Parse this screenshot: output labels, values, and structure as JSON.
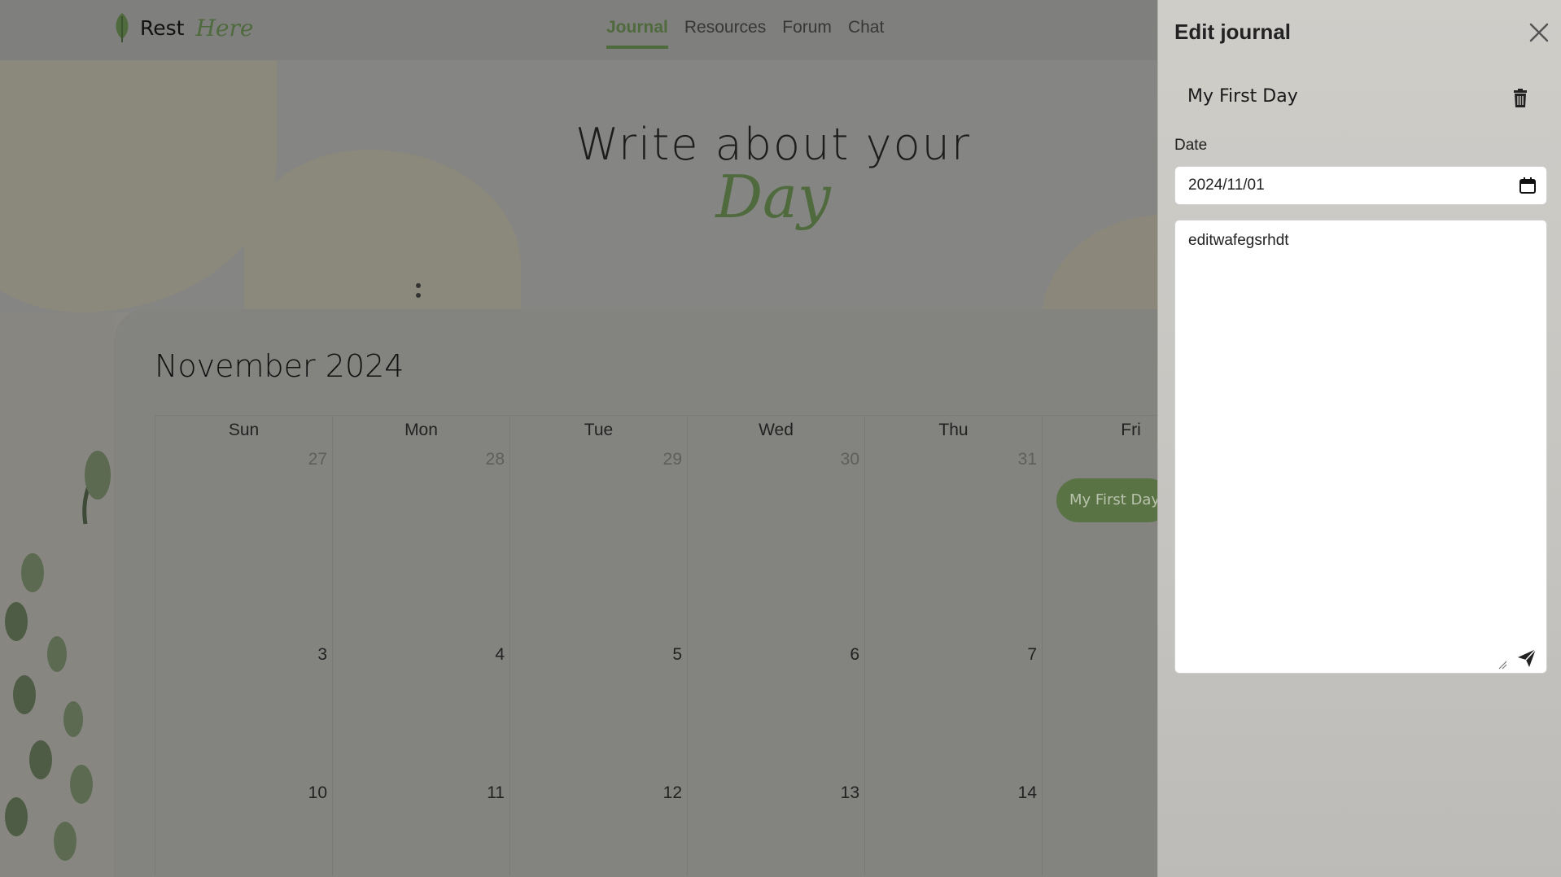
{
  "app": {
    "brand_rest": "Rest",
    "brand_here": "Here"
  },
  "nav": {
    "items": [
      {
        "label": "Journal",
        "active": true
      },
      {
        "label": "Resources"
      },
      {
        "label": "Forum"
      },
      {
        "label": "Chat"
      }
    ]
  },
  "hero": {
    "title": "Write about your",
    "subtitle": "Day"
  },
  "calendar": {
    "title": "November 2024",
    "days": [
      "Sun",
      "Mon",
      "Tue",
      "Wed",
      "Thu",
      "Fri"
    ],
    "rows": [
      [
        "27",
        "28",
        "29",
        "30",
        "31",
        ""
      ],
      [
        "3",
        "4",
        "5",
        "6",
        "7",
        ""
      ],
      [
        "10",
        "11",
        "12",
        "13",
        "14",
        ""
      ]
    ],
    "event_label": "My First Day"
  },
  "drawer": {
    "title": "Edit journal",
    "entry_title": "My First Day",
    "date_label": "Date",
    "date_value": "2024/11/01",
    "body_text": "editwafegsrhdt"
  },
  "colors": {
    "accent": "#4f6a3d",
    "overlay": "#7f7f7e",
    "drawer_bg": "#cfcdc8"
  },
  "icons": [
    "leaf-logo-icon",
    "close-icon",
    "trash-icon",
    "calendar-icon",
    "send-icon",
    "resize-grip-icon"
  ]
}
